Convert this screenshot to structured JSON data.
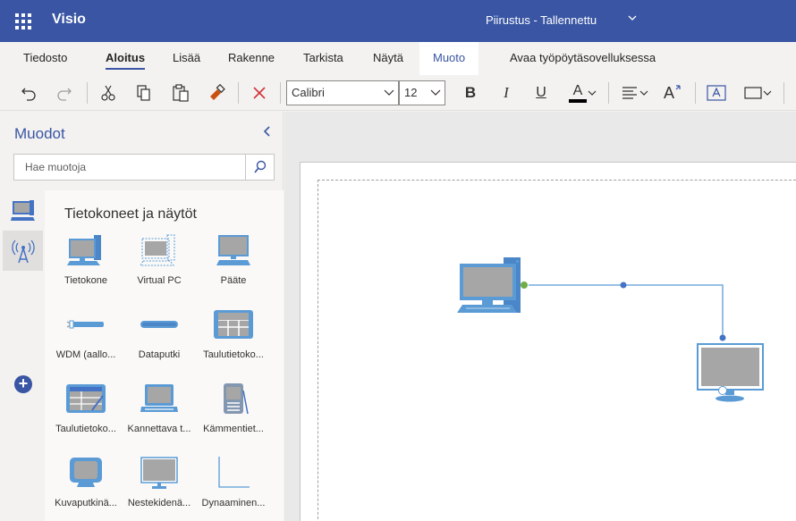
{
  "app": {
    "name": "Visio",
    "doc_title": "Piirustus - Tallennettu"
  },
  "tabs": [
    "Tiedosto",
    "Aloitus",
    "Lisää",
    "Rakenne",
    "Tarkista",
    "Näytä",
    "Muoto",
    "Avaa työpöytäsovelluksessa"
  ],
  "toolbar": {
    "font_name": "Calibri",
    "font_size": "12",
    "bold": "B",
    "italic": "I",
    "underline": "U",
    "font_color": "A",
    "grow_font": "A"
  },
  "shapes_pane": {
    "title": "Muodot",
    "search_placeholder": "Hae muotoja",
    "category": "Tietokoneet ja näytöt",
    "shapes": [
      "Tietokone",
      "Virtual PC",
      "Pääte",
      "WDM (aallo...",
      "Dataputki",
      "Taulutietoko...",
      "Taulutietoko...",
      "Kannettava t...",
      "Kämmentiet...",
      "Kuvaputkinä...",
      "Nestekidenä...",
      "Dynaaminen..."
    ]
  },
  "colors": {
    "brand": "#3955a3",
    "shape_blue": "#5b9bd5",
    "screen_gray": "#a6a6a6",
    "connector_green": "#70ad47"
  },
  "icons": [
    "waffle-icon",
    "chevron-down-icon",
    "undo-icon",
    "redo-icon",
    "cut-icon",
    "copy-icon",
    "paste-icon",
    "format-painter-icon",
    "delete-icon",
    "align-icon",
    "grow-font-icon",
    "text-box-icon",
    "shape-icon",
    "search-icon",
    "chevron-left-icon",
    "computer-stencil-icon",
    "network-stencil-icon",
    "add-icon"
  ]
}
